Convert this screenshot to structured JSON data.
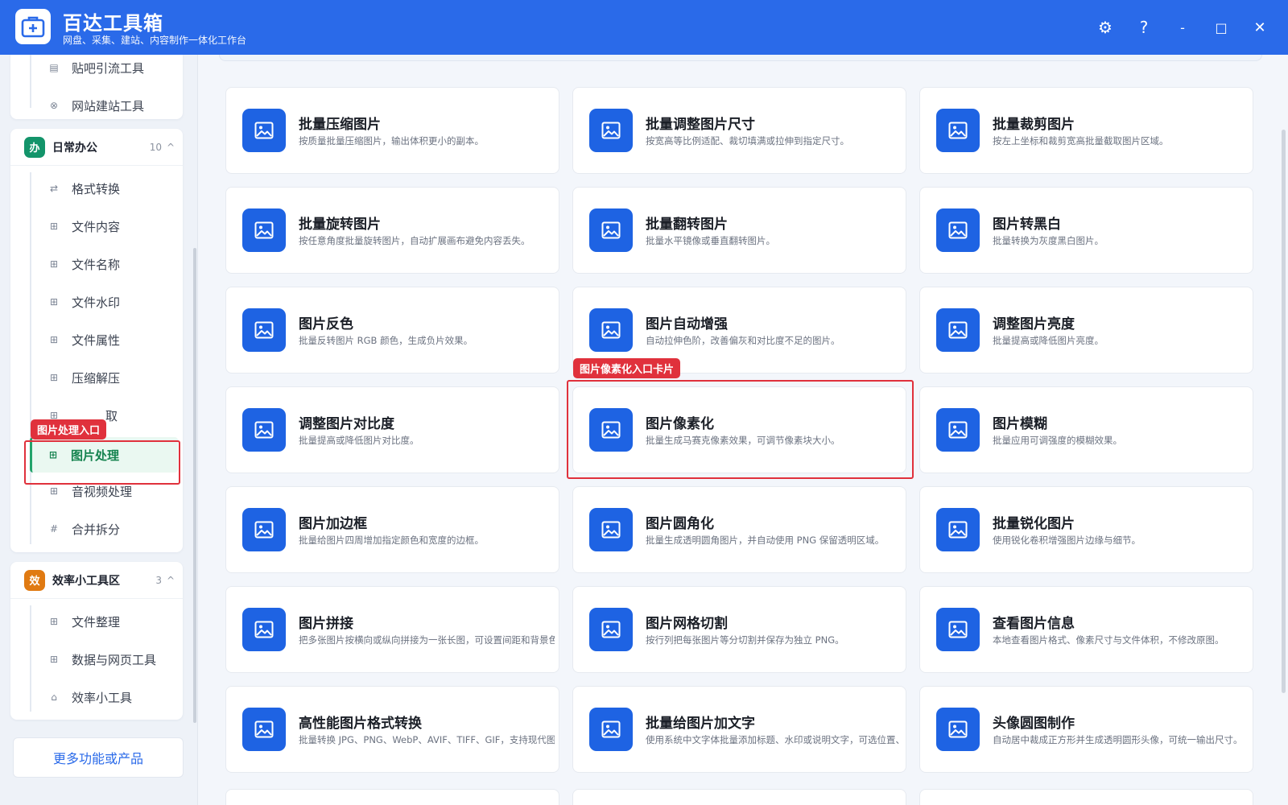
{
  "app": {
    "title": "百达工具箱",
    "subtitle": "网盘、采集、建站、内容制作一体化工作台"
  },
  "window_controls": {
    "settings": "⚙",
    "help": "?",
    "minimize": "-",
    "maximize": "□",
    "close": "✕"
  },
  "sidebar": {
    "top_items": [
      {
        "label": "贴吧引流工具",
        "icon": "document-icon"
      },
      {
        "label": "网站建站工具",
        "icon": "globe-icon"
      }
    ],
    "groups": [
      {
        "badge": "办",
        "badge_color": "#13946a",
        "title": "日常办公",
        "count": "10",
        "toggle": "^",
        "items": [
          {
            "label": "格式转换",
            "icon": "swap-icon"
          },
          {
            "label": "文件内容",
            "icon": "grid-icon"
          },
          {
            "label": "文件名称",
            "icon": "grid-icon"
          },
          {
            "label": "文件水印",
            "icon": "grid-icon"
          },
          {
            "label": "文件属性",
            "icon": "grid-icon"
          },
          {
            "label": "压缩解压",
            "icon": "grid-icon"
          },
          {
            "label": "",
            "tail": "取",
            "icon": "grid-icon"
          },
          {
            "label": "图片处理",
            "icon": "grid-icon",
            "active": true
          },
          {
            "label": "音视频处理",
            "icon": "grid-icon"
          },
          {
            "label": "合并拆分",
            "icon": "hash-icon"
          }
        ]
      },
      {
        "badge": "效",
        "badge_color": "#e07a12",
        "title": "效率小工具区",
        "count": "3",
        "toggle": "^",
        "items": [
          {
            "label": "文件整理",
            "icon": "grid-icon"
          },
          {
            "label": "数据与网页工具",
            "icon": "grid-icon"
          },
          {
            "label": "效率小工具",
            "icon": "briefcase-icon"
          }
        ]
      }
    ],
    "more_button": "更多功能或产品"
  },
  "annotations": {
    "sidebar_tag": "图片处理入口",
    "card_tag": "图片像素化入口卡片"
  },
  "cards": [
    {
      "title": "批量压缩图片",
      "desc": "按质量批量压缩图片，输出体积更小的副本。"
    },
    {
      "title": "批量调整图片尺寸",
      "desc": "按宽高等比例适配、裁切填满或拉伸到指定尺寸。"
    },
    {
      "title": "批量裁剪图片",
      "desc": "按左上坐标和裁剪宽高批量截取图片区域。"
    },
    {
      "title": "批量旋转图片",
      "desc": "按任意角度批量旋转图片，自动扩展画布避免内容丢失。"
    },
    {
      "title": "批量翻转图片",
      "desc": "批量水平镜像或垂直翻转图片。"
    },
    {
      "title": "图片转黑白",
      "desc": "批量转换为灰度黑白图片。"
    },
    {
      "title": "图片反色",
      "desc": "批量反转图片 RGB 颜色，生成负片效果。"
    },
    {
      "title": "图片自动增强",
      "desc": "自动拉伸色阶，改善偏灰和对比度不足的图片。"
    },
    {
      "title": "调整图片亮度",
      "desc": "批量提高或降低图片亮度。"
    },
    {
      "title": "调整图片对比度",
      "desc": "批量提高或降低图片对比度。"
    },
    {
      "title": "图片像素化",
      "desc": "批量生成马赛克像素效果，可调节像素块大小。"
    },
    {
      "title": "图片模糊",
      "desc": "批量应用可调强度的模糊效果。"
    },
    {
      "title": "图片加边框",
      "desc": "批量给图片四周增加指定颜色和宽度的边框。"
    },
    {
      "title": "图片圆角化",
      "desc": "批量生成透明圆角图片，并自动使用 PNG 保留透明区域。"
    },
    {
      "title": "批量锐化图片",
      "desc": "使用锐化卷积增强图片边缘与细节。"
    },
    {
      "title": "图片拼接",
      "desc": "把多张图片按横向或纵向拼接为一张长图，可设置间距和背景色。"
    },
    {
      "title": "图片网格切割",
      "desc": "按行列把每张图片等分切割并保存为独立 PNG。"
    },
    {
      "title": "查看图片信息",
      "desc": "本地查看图片格式、像素尺寸与文件体积，不修改原图。"
    },
    {
      "title": "高性能图片格式转换",
      "desc": "批量转换 JPG、PNG、WebP、AVIF、TIFF、GIF，支持现代图片"
    },
    {
      "title": "批量给图片加文字",
      "desc": "使用系统中文字体批量添加标题、水印或说明文字，可选位置、"
    },
    {
      "title": "头像圆图制作",
      "desc": "自动居中裁成正方形并生成透明圆形头像，可统一输出尺寸。"
    }
  ]
}
